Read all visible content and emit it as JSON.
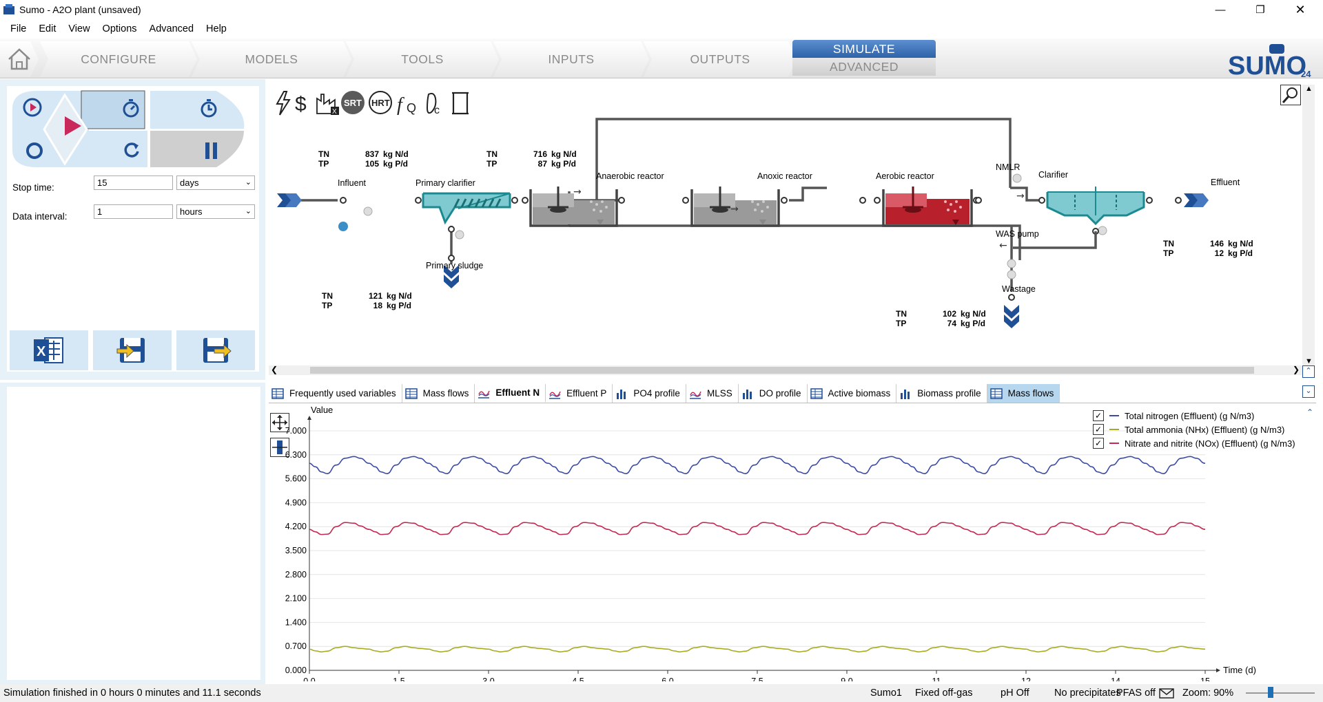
{
  "window": {
    "title": "Sumo - A2O plant (unsaved)"
  },
  "menu": [
    "File",
    "Edit",
    "View",
    "Options",
    "Advanced",
    "Help"
  ],
  "ribbon": {
    "tabs": [
      "CONFIGURE",
      "MODELS",
      "TOOLS",
      "INPUTS",
      "OUTPUTS"
    ],
    "simulate": "SIMULATE",
    "advanced": "ADVANCED",
    "logo_text": "SUMO",
    "logo_version": "24"
  },
  "sim_controls": {
    "stop_time_label": "Stop time:",
    "stop_time_value": "15",
    "stop_time_unit": "days",
    "data_interval_label": "Data interval:",
    "data_interval_value": "1",
    "data_interval_unit": "hours"
  },
  "toolbar_icons": [
    "lightning-icon",
    "dollar-icon",
    "no-factory-icon",
    "srt-icon",
    "hrt-icon",
    "function-q-icon",
    "carbon-footprint-icon",
    "scroll-icon"
  ],
  "toolbar_labels": {
    "srt": "SRT",
    "hrt": "HRT"
  },
  "flowsheet": {
    "units": {
      "influent": "Influent",
      "primary_clarifier": "Primary clarifier",
      "primary_sludge": "Primary sludge",
      "anaerobic": "Anaerobic reactor",
      "anoxic": "Anoxic reactor",
      "aerobic": "Aerobic reactor",
      "nmlr": "NMLR",
      "clarifier": "Clarifier",
      "effluent": "Effluent",
      "was_pump": "WAS pump",
      "wastage": "Wastage"
    },
    "mass_flows": [
      {
        "id": "influent",
        "tn": "837",
        "tn_unit": "kg N/d",
        "tp": "105",
        "tp_unit": "kg P/d"
      },
      {
        "id": "after_primary",
        "tn": "716",
        "tn_unit": "kg N/d",
        "tp": "87",
        "tp_unit": "kg P/d"
      },
      {
        "id": "primary_sludge",
        "tn": "121",
        "tn_unit": "kg N/d",
        "tp": "18",
        "tp_unit": "kg P/d"
      },
      {
        "id": "wastage",
        "tn": "102",
        "tn_unit": "kg N/d",
        "tp": "74",
        "tp_unit": "kg P/d"
      },
      {
        "id": "effluent",
        "tn": "146",
        "tn_unit": "kg N/d",
        "tp": "12",
        "tp_unit": "kg P/d"
      }
    ],
    "tn_label": "TN",
    "tp_label": "TP"
  },
  "bottom_tabs": [
    {
      "label": "Frequently used variables",
      "icon": "table-icon"
    },
    {
      "label": "Mass flows",
      "icon": "table-icon"
    },
    {
      "label": "Effluent N",
      "icon": "line-chart-icon",
      "active": true
    },
    {
      "label": "Effluent P",
      "icon": "line-chart-icon"
    },
    {
      "label": "PO4 profile",
      "icon": "bar-chart-icon"
    },
    {
      "label": "MLSS",
      "icon": "line-chart-icon"
    },
    {
      "label": "DO profile",
      "icon": "bar-chart-icon"
    },
    {
      "label": "Active biomass",
      "icon": "table-icon"
    },
    {
      "label": "Biomass profile",
      "icon": "bar-chart-icon"
    },
    {
      "label": "Mass flows",
      "icon": "table-icon",
      "selected": true
    }
  ],
  "chart_data": {
    "type": "line",
    "ylabel": "Value",
    "xlabel": "Time  (d)",
    "xlim": [
      0,
      15
    ],
    "ylim": [
      0,
      7.0
    ],
    "yticks": [
      "0.000",
      "0.700",
      "1.400",
      "2.100",
      "2.800",
      "3.500",
      "4.200",
      "4.900",
      "5.600",
      "6.300",
      "7.000"
    ],
    "xticks": [
      "0.0",
      "1.5",
      "3.0",
      "4.5",
      "6.0",
      "7.5",
      "9.0",
      "11",
      "12",
      "14",
      "15"
    ],
    "xtick_values": [
      0,
      1.5,
      3.0,
      4.5,
      6.0,
      7.5,
      9.0,
      10.5,
      12,
      13.5,
      15
    ],
    "grid": true,
    "legend_position": "top-right",
    "period_days": 1,
    "series": [
      {
        "name": "Total nitrogen (Effluent) (g N/m3)",
        "color": "#3a4aa8",
        "checked": true,
        "x": [
          0,
          0.1,
          0.2,
          0.3,
          0.45,
          0.6,
          0.75,
          0.85,
          1.0,
          1.1,
          1.2,
          1.3,
          1.45,
          1.6,
          1.75,
          1.85,
          2.0
        ],
        "y": [
          6.05,
          5.95,
          5.8,
          5.75,
          6.0,
          6.2,
          6.25,
          6.2,
          6.05,
          5.95,
          5.8,
          5.75,
          6.0,
          6.2,
          6.25,
          6.2,
          6.05
        ]
      },
      {
        "name": "Total ammonia (NHx) (Effluent) (g N/m3)",
        "color": "#a9ac1c",
        "checked": true,
        "x": [
          0,
          0.1,
          0.2,
          0.3,
          0.45,
          0.6,
          0.75,
          0.85,
          1.0
        ],
        "y": [
          0.62,
          0.57,
          0.54,
          0.56,
          0.66,
          0.7,
          0.66,
          0.64,
          0.62
        ]
      },
      {
        "name": "Nitrate and nitrite (NOx) (Effluent) (g N/m3)",
        "color": "#c22a52",
        "checked": true,
        "x": [
          0,
          0.1,
          0.2,
          0.3,
          0.45,
          0.6,
          0.75,
          0.85,
          1.0
        ],
        "y": [
          4.12,
          4.05,
          3.97,
          3.98,
          4.2,
          4.32,
          4.3,
          4.22,
          4.12
        ]
      }
    ]
  },
  "status": {
    "message": "Simulation finished in 0 hours 0 minutes and 11.1 seconds",
    "model": "Sumo1",
    "offgas": "Fixed off-gas",
    "ph": "pH Off",
    "precip": "No precipitates",
    "pfas": "PFAS off",
    "zoom": "Zoom: 90%"
  }
}
